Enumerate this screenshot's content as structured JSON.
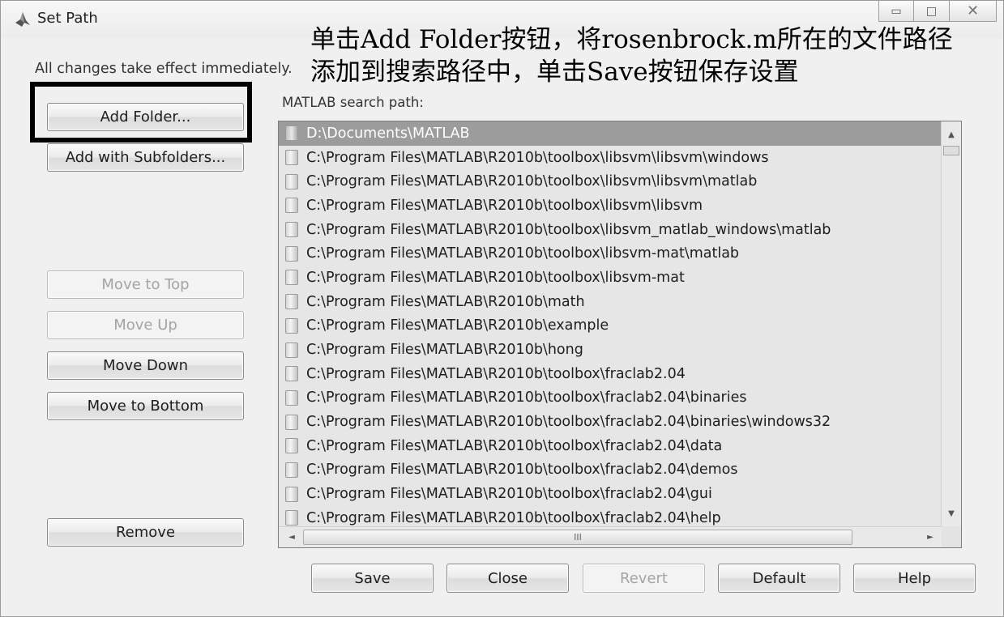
{
  "window": {
    "title": "Set Path",
    "app_icon": "matlab-icon",
    "controls": {
      "minimize": "▭",
      "maximize": "□",
      "close": "✕"
    }
  },
  "annotation": {
    "line1": "单击Add Folder按钮，将rosenbrock.m所在的文件路径",
    "line2": "添加到搜索路径中，单击Save按钮保存设置"
  },
  "info_text": "All changes take effect immediately.",
  "path_label": "MATLAB search path:",
  "side_buttons": {
    "add_folder": "Add Folder...",
    "add_with_subfolders": "Add with Subfolders...",
    "move_to_top": "Move to Top",
    "move_up": "Move Up",
    "move_down": "Move Down",
    "move_to_bottom": "Move to Bottom",
    "remove": "Remove"
  },
  "paths": [
    "D:\\Documents\\MATLAB",
    "C:\\Program Files\\MATLAB\\R2010b\\toolbox\\libsvm\\libsvm\\windows",
    "C:\\Program Files\\MATLAB\\R2010b\\toolbox\\libsvm\\libsvm\\matlab",
    "C:\\Program Files\\MATLAB\\R2010b\\toolbox\\libsvm\\libsvm",
    "C:\\Program Files\\MATLAB\\R2010b\\toolbox\\libsvm_matlab_windows\\matlab",
    "C:\\Program Files\\MATLAB\\R2010b\\toolbox\\libsvm-mat\\matlab",
    "C:\\Program Files\\MATLAB\\R2010b\\toolbox\\libsvm-mat",
    "C:\\Program Files\\MATLAB\\R2010b\\math",
    "C:\\Program Files\\MATLAB\\R2010b\\example",
    "C:\\Program Files\\MATLAB\\R2010b\\hong",
    "C:\\Program Files\\MATLAB\\R2010b\\toolbox\\fraclab2.04",
    "C:\\Program Files\\MATLAB\\R2010b\\toolbox\\fraclab2.04\\binaries",
    "C:\\Program Files\\MATLAB\\R2010b\\toolbox\\fraclab2.04\\binaries\\windows32",
    "C:\\Program Files\\MATLAB\\R2010b\\toolbox\\fraclab2.04\\data",
    "C:\\Program Files\\MATLAB\\R2010b\\toolbox\\fraclab2.04\\demos",
    "C:\\Program Files\\MATLAB\\R2010b\\toolbox\\fraclab2.04\\gui",
    "C:\\Program Files\\MATLAB\\R2010b\\toolbox\\fraclab2.04\\help"
  ],
  "selected_path_index": 0,
  "scrollbar": {
    "up": "▲",
    "down": "▼",
    "left": "◄",
    "right": "►",
    "grip": "III"
  },
  "bottom_buttons": {
    "save": "Save",
    "close": "Close",
    "revert": "Revert",
    "default": "Default",
    "help": "Help"
  }
}
